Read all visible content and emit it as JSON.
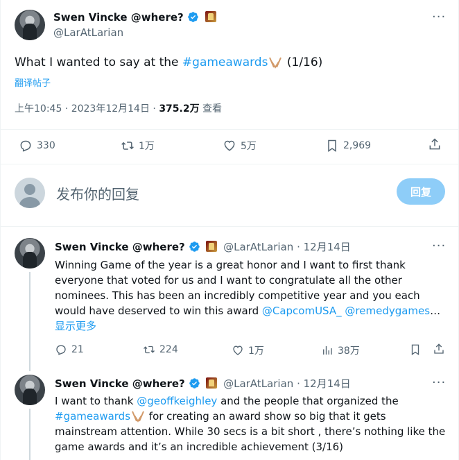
{
  "main_tweet": {
    "author_name": "Swen Vincke @where?",
    "handle": "@LarAtLarian",
    "text_before": "What I wanted to say at the ",
    "hashtag": "#gameawards",
    "text_after": " (1/16)",
    "translate": "翻译帖子",
    "time": "上午10:45 · 2023年12月14日 · ",
    "views_count": "375.2万",
    "views_label": " 查看",
    "stats": {
      "replies": "330",
      "retweets": "1万",
      "likes": "5万",
      "bookmarks": "2,969"
    }
  },
  "composer": {
    "placeholder": "发布你的回复",
    "reply_button": "回复"
  },
  "replies": [
    {
      "author_name": "Swen Vincke @where?",
      "handle": "@LarAtLarian",
      "date": "12月14日",
      "line1": "Winning Game of the year is a great honor and I want to first thank",
      "line2": "everyone that voted for us and I want to congratulate all the other",
      "line3": "nominees. This has been an incredibly competitive year and you each",
      "line4_prefix": "would have deserved to win this award  ",
      "mention1": "@CapcomUSA_",
      "mention2": "@remedygames",
      "ellipsis": "…",
      "show_more": "显示更多",
      "stats": {
        "replies": "21",
        "retweets": "224",
        "likes": "1万",
        "views": "38万"
      }
    },
    {
      "author_name": "Swen Vincke @where?",
      "handle": "@LarAtLarian",
      "date": "12月14日",
      "line1_prefix": "I want to thank ",
      "mention": "@geoffkeighley",
      "line1_suffix": "  and the people that organized the",
      "hashtag": "#gameawards",
      "line2_suffix": "  for creating an award show so big that it gets",
      "line3": "mainstream attention. While 30 secs is a bit short , there’s nothing like the",
      "line4": "game awards and it’s an incredible achievement (3/16)"
    }
  ],
  "colors": {
    "accent": "#1d9bf0",
    "text": "#0f1419",
    "muted": "#536471",
    "reply_button_disabled": "#8ecdf8"
  }
}
